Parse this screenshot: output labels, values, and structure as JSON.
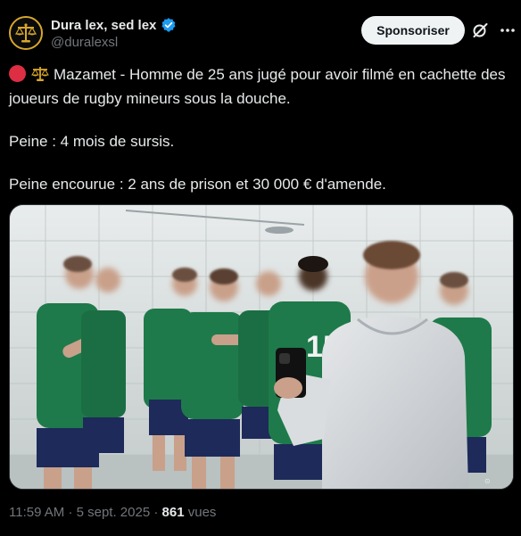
{
  "author": {
    "display_name": "Dura lex, sed lex",
    "handle": "@duralexsl",
    "verified": true
  },
  "header": {
    "sponsor_label": "Sponsoriser"
  },
  "post": {
    "line1": "Mazamet - Homme de 25 ans jugé pour avoir filmé en cachette des joueurs de rugby mineurs sous la douche.",
    "line2": "Peine : 4 mois de sursis.",
    "line3": "Peine encourue : 2 ans de prison et 30 000 € d'amende."
  },
  "media": {
    "jersey_number": "15"
  },
  "meta": {
    "time": "11:59 AM",
    "date": "5 sept. 2025",
    "separator": "·",
    "views_count": "861",
    "views_label": "vues"
  },
  "icons": {
    "avatar": "scales-of-justice-logo",
    "verified": "verified-badge-icon",
    "grok": "grok-icon",
    "more": "more-dots-icon",
    "status": "red-circle-icon",
    "emoji": "scales-emoji-icon"
  },
  "colors": {
    "background": "#000000",
    "text": "#e7e9ea",
    "muted": "#71767b",
    "verified": "#1d9bf0",
    "sponsor_bg": "#eff3f4",
    "jersey_green": "#1e7a4a",
    "red_dot": "#dd2e44",
    "gold": "#d9a72a"
  }
}
